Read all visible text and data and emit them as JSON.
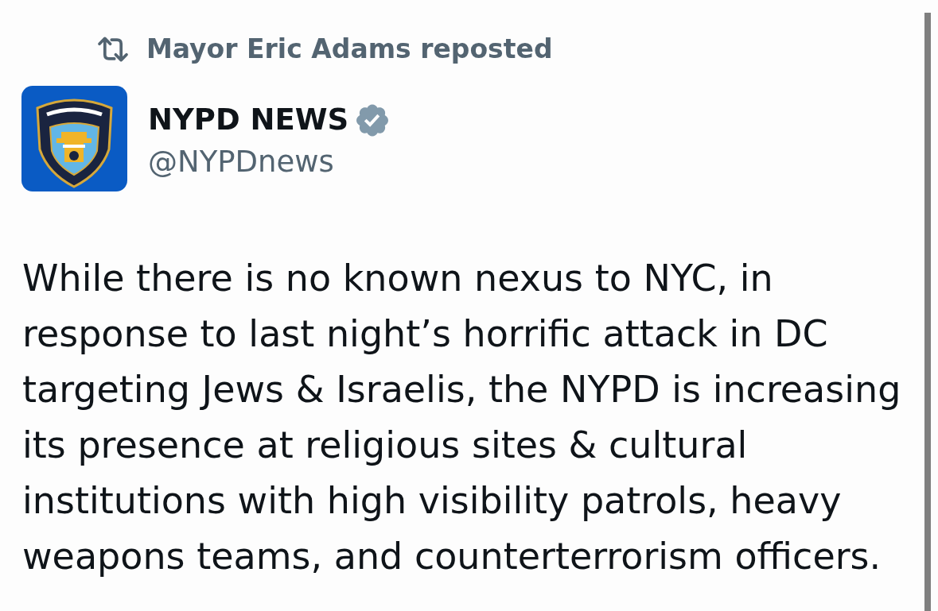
{
  "repost": {
    "label": "Mayor Eric Adams reposted"
  },
  "author": {
    "name": "NYPD NEWS",
    "verified": true,
    "handle": "@NYPDnews"
  },
  "text": "While there is no known nexus to NYC, in response to last night’s horrific attack in DC targeting Jews & Israelis, the NYPD is increasing its presence at religious sites & cultural institutions with high visibility patrols, heavy weapons teams, and counterterrorism officers."
}
